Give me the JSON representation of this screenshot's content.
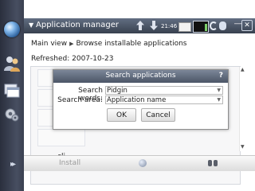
{
  "window": {
    "title": "Application manager",
    "menu_arrow": "▼",
    "clock": "21:46",
    "minimize_glyph": "―",
    "close_glyph": "✕"
  },
  "breadcrumb": {
    "root": "Main view",
    "separator": "▶",
    "current": "Browse installable applications"
  },
  "refreshed": "Refreshed: 2007-10-23",
  "list": {
    "visible_item": "cli"
  },
  "toolbar": {
    "install_label": "Install"
  },
  "dialog": {
    "title": "Search applications",
    "help": "?",
    "search_words_label": "Search words:",
    "search_words_value": "Pidgin",
    "search_area_label": "Search area:",
    "search_area_value": "Application name",
    "ok_label": "OK",
    "cancel_label": "Cancel",
    "caret": "▼"
  },
  "icons": {
    "left_nav": [
      "globe-icon",
      "contacts-icon",
      "windows-icon",
      "settings-icon",
      "expand-icon"
    ],
    "status": [
      "transfer-up-icon",
      "transfer-down-icon",
      "mail-icon",
      "battery-icon",
      "wifi-icon",
      "bluetooth-icon"
    ],
    "toolbar": [
      "details-icon",
      "search-icon"
    ]
  },
  "colors": {
    "title_bar": "#4b5566",
    "nav_bar": "#3a4050"
  }
}
